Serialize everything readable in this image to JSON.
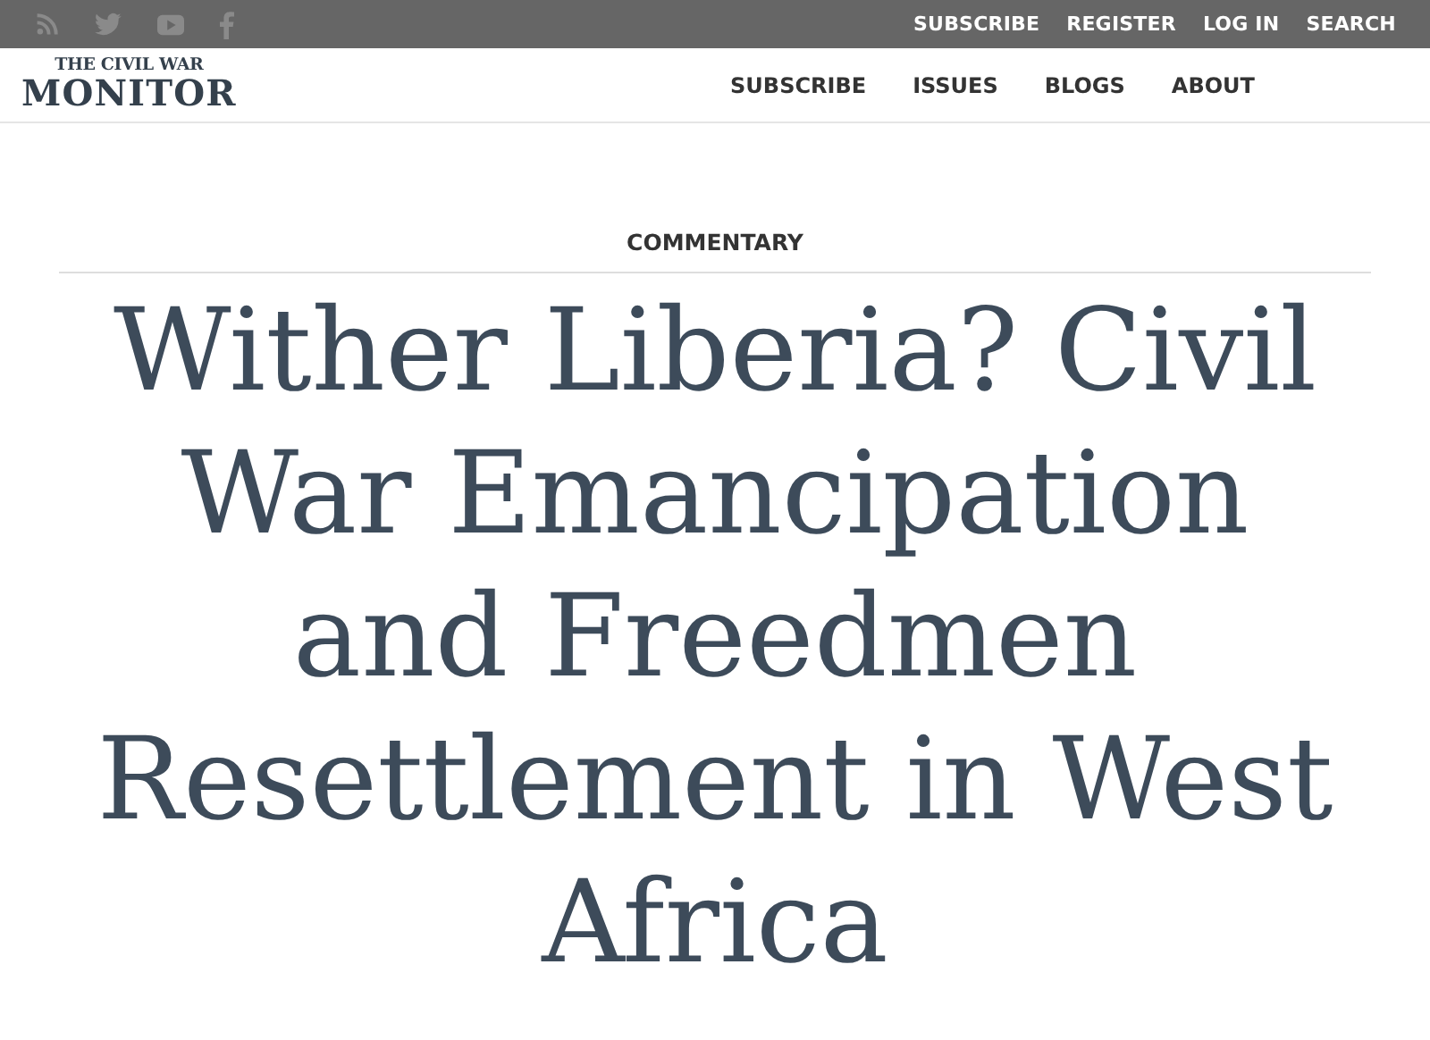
{
  "top_bar": {
    "social_links": [
      {
        "kind": "rss"
      },
      {
        "kind": "twitter"
      },
      {
        "kind": "youtube"
      },
      {
        "kind": "facebook"
      }
    ],
    "links": [
      "SUBSCRIBE",
      "REGISTER",
      "LOG IN",
      "SEARCH"
    ]
  },
  "header": {
    "logo": {
      "line_1": "THE CIVIL WAR",
      "line_2": "MONITOR"
    },
    "nav": [
      "SUBSCRIBE",
      "ISSUES",
      "BLOGS",
      "ABOUT"
    ]
  },
  "article": {
    "category": "COMMENTARY",
    "title": "Wither Liberia? Civil War Emancipation and Freedmen Resettlement in West Africa"
  }
}
